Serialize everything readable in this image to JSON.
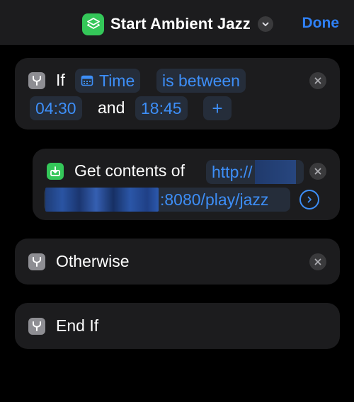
{
  "header": {
    "title": "Start Ambient Jazz",
    "done_label": "Done"
  },
  "if_block": {
    "if_label": "If",
    "variable_token": "Time",
    "condition_token": "is between",
    "start_time": "04:30",
    "and_label": "and",
    "end_time": "18:45",
    "add_label": "+"
  },
  "get_contents": {
    "label": "Get contents of",
    "url_prefix": "http://",
    "url_suffix": ":8080/play/jazz"
  },
  "otherwise_block": {
    "label": "Otherwise"
  },
  "end_if_block": {
    "label": "End If"
  },
  "colors": {
    "accent": "#2f80f5",
    "token_text": "#3d8ef7",
    "token_bg": "#252d3a",
    "card_bg": "#1c1c1e",
    "green": "#34c759"
  },
  "icons": {
    "app": "shortcuts-app-icon",
    "if": "branch-icon",
    "calendar": "calendar-icon",
    "download": "download-icon",
    "remove": "close-icon",
    "go": "chevron-right-circle-icon"
  }
}
